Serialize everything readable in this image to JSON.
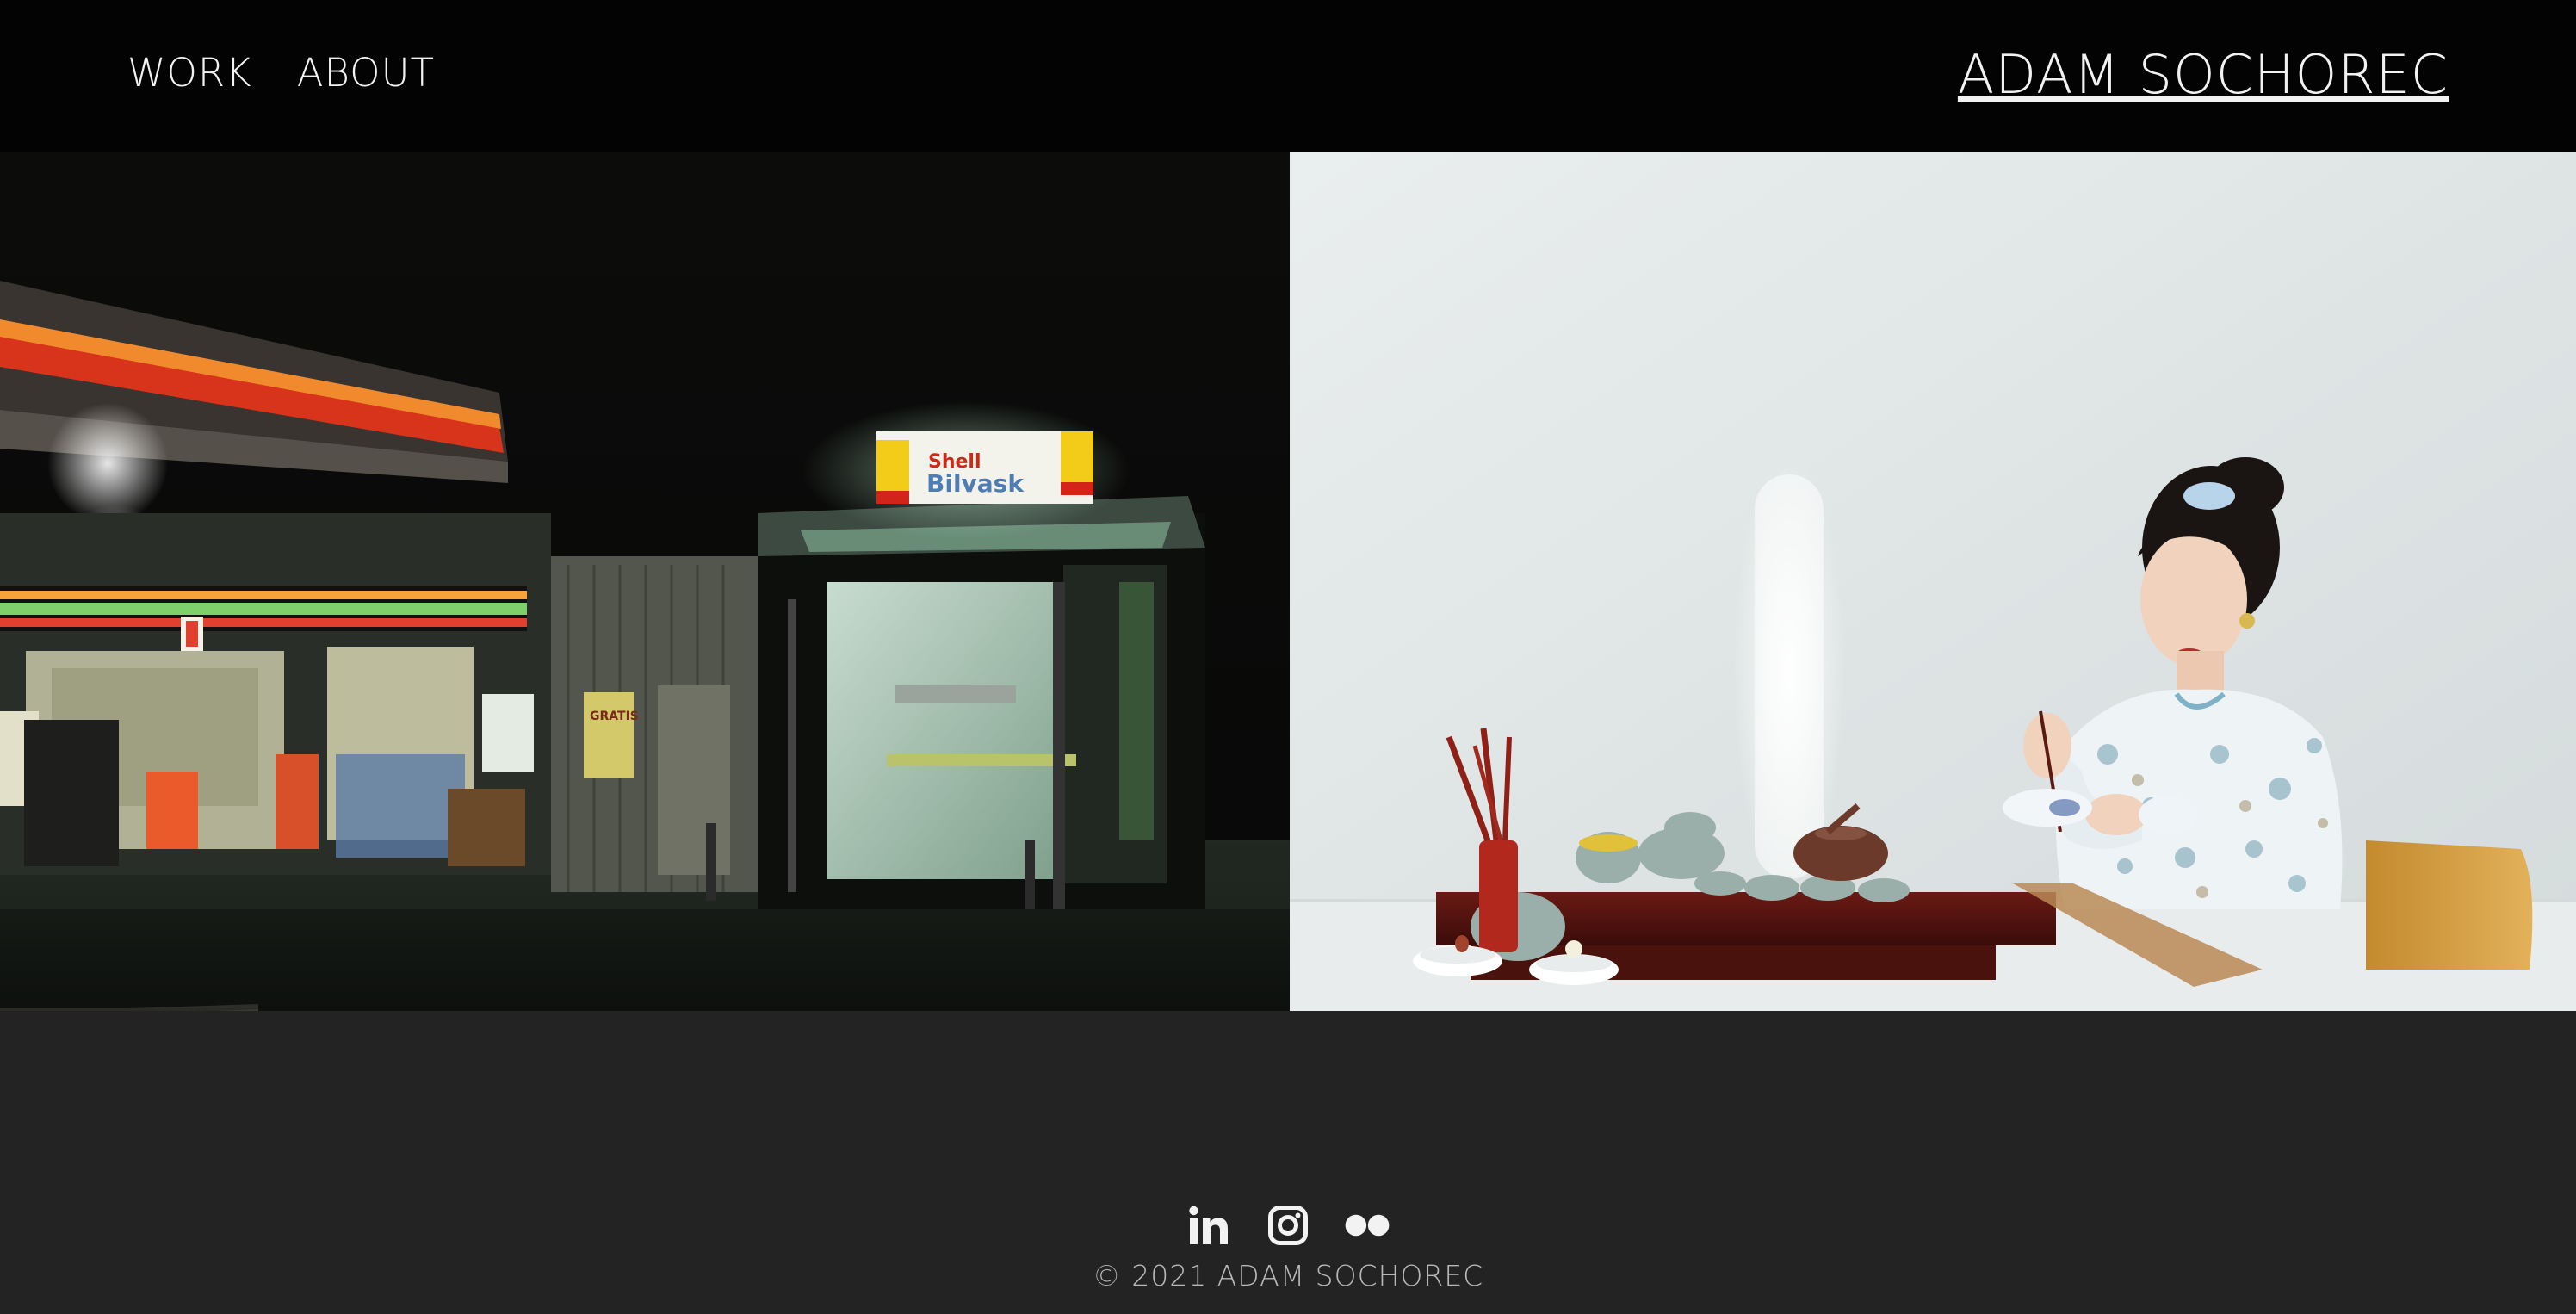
{
  "nav": {
    "items": [
      {
        "label": "WORK"
      },
      {
        "label": "ABOUT"
      }
    ]
  },
  "site": {
    "title": "ADAM SOCHOREC"
  },
  "gallery": {
    "left_photo": {
      "sign_top": "Shell",
      "sign_bottom": "Bilvask",
      "poster_label": "GRATIS"
    },
    "right_photo": {}
  },
  "footer": {
    "socials": [
      {
        "icon": "linkedin-icon"
      },
      {
        "icon": "instagram-icon"
      },
      {
        "icon": "flickr-icon"
      }
    ],
    "copyright": "© 2021 ADAM SOCHOREC"
  },
  "colors": {
    "header_bg": "#030303",
    "footer_bg": "#232323",
    "text": "#f2f2f2",
    "footer_text": "#b8b8b8"
  }
}
